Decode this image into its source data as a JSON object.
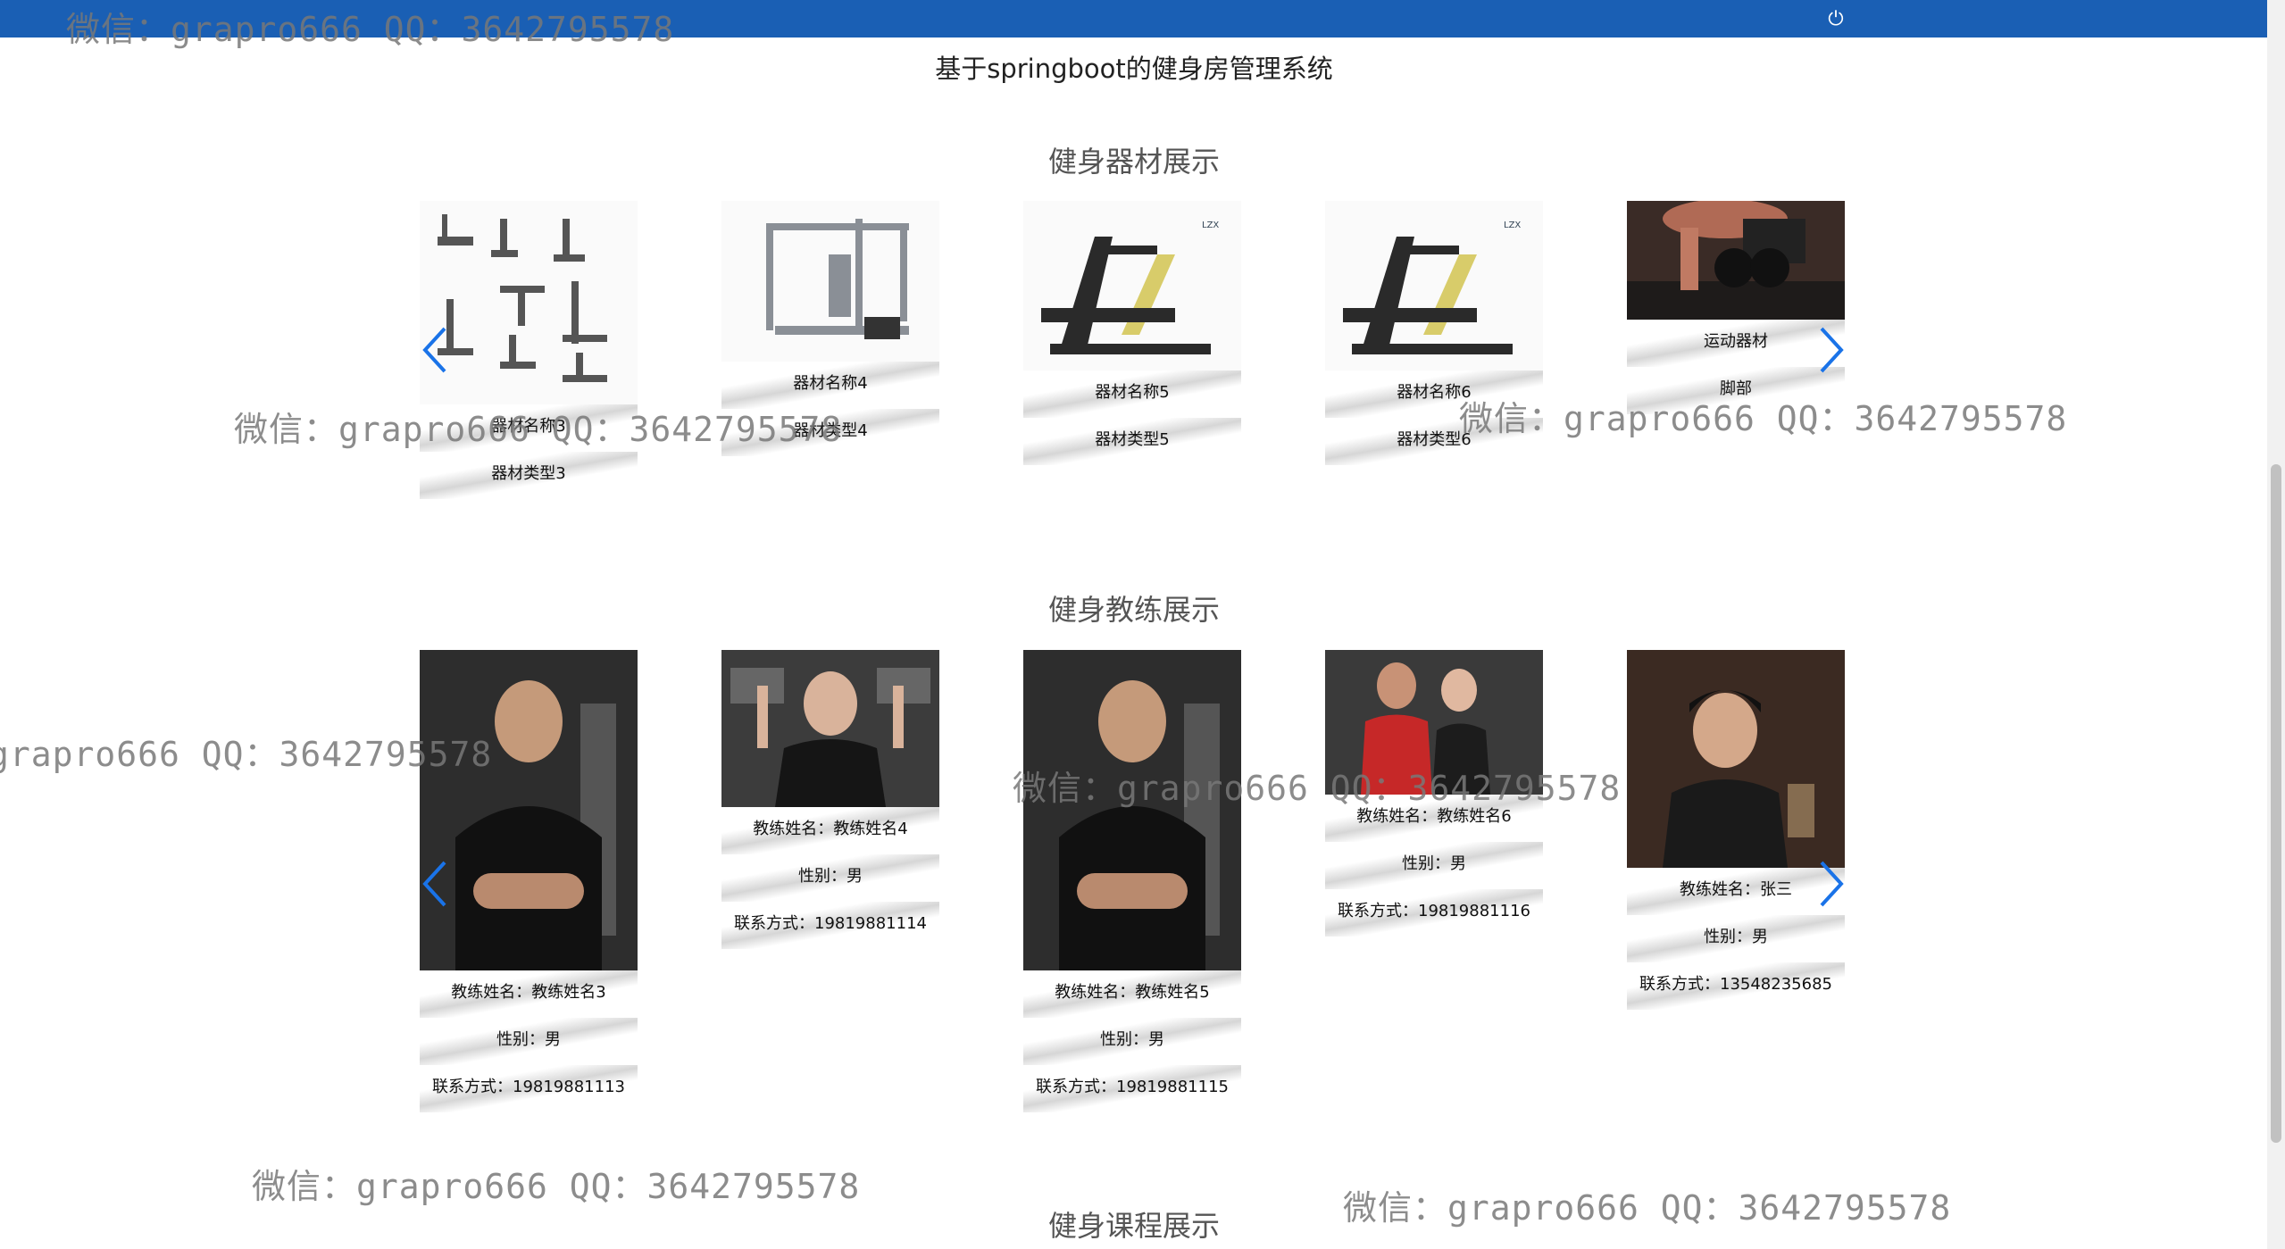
{
  "header": {
    "power_icon": "power-icon",
    "title": "基于springboot的健身房管理系统"
  },
  "equipment_section": {
    "title": "健身器材展示",
    "items": [
      {
        "name": "器材名称3",
        "type": "器材类型3"
      },
      {
        "name": "器材名称4",
        "type": "器材类型4"
      },
      {
        "name": "器材名称5",
        "type": "器材类型5"
      },
      {
        "name": "器材名称6",
        "type": "器材类型6"
      },
      {
        "name": "运动器材",
        "type": "脚部"
      }
    ]
  },
  "coach_section": {
    "title": "健身教练展示",
    "items": [
      {
        "name": "教练姓名：教练姓名3",
        "gender": "性别：男",
        "contact": "联系方式：19819881113"
      },
      {
        "name": "教练姓名：教练姓名4",
        "gender": "性别：男",
        "contact": "联系方式：19819881114"
      },
      {
        "name": "教练姓名：教练姓名5",
        "gender": "性别：男",
        "contact": "联系方式：19819881115"
      },
      {
        "name": "教练姓名：教练姓名6",
        "gender": "性别：男",
        "contact": "联系方式：19819881116"
      },
      {
        "name": "教练姓名：张三",
        "gender": "性别：男",
        "contact": "联系方式：13548235685"
      }
    ]
  },
  "course_section": {
    "title": "健身课程展示"
  },
  "watermark": "微信：grapro666 QQ：3642795578",
  "colors": {
    "topbar": "#1a5fb4",
    "arrow": "#1a73e8"
  }
}
